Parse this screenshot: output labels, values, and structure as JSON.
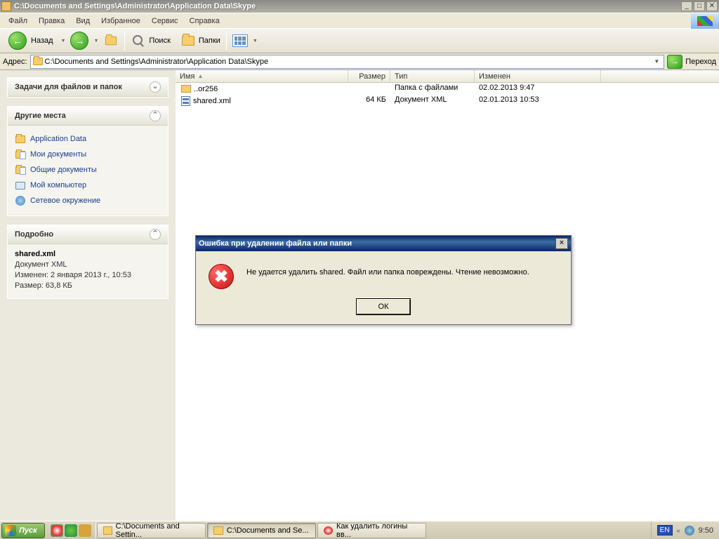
{
  "window": {
    "title": "C:\\Documents and Settings\\Administrator\\Application Data\\Skype"
  },
  "menu": {
    "items": [
      "Файл",
      "Правка",
      "Вид",
      "Избранное",
      "Сервис",
      "Справка"
    ]
  },
  "toolbar": {
    "back": "Назад",
    "search": "Поиск",
    "folders": "Папки"
  },
  "addressbar": {
    "label": "Адрес:",
    "value": "C:\\Documents and Settings\\Administrator\\Application Data\\Skype",
    "go": "Переход"
  },
  "panels": {
    "tasks": {
      "title": "Задачи для файлов и папок"
    },
    "places": {
      "title": "Другие места",
      "items": [
        "Application Data",
        "Мои документы",
        "Общие документы",
        "Мой компьютер",
        "Сетевое окружение"
      ]
    },
    "details": {
      "title": "Подробно",
      "file": "shared.xml",
      "type": "Документ XML",
      "modified": "Изменен: 2 января 2013 г., 10:53",
      "size": "Размер: 63,8 КБ"
    }
  },
  "columns": {
    "name": "Имя",
    "size": "Размер",
    "type": "Тип",
    "modified": "Изменен"
  },
  "files": [
    {
      "name": "..or256",
      "size": "",
      "type": "Папка с файлами",
      "modified": "02.02.2013 9:47",
      "kind": "folder"
    },
    {
      "name": "shared.xml",
      "size": "64 КБ",
      "type": "Документ XML",
      "modified": "02.01.2013 10:53",
      "kind": "xml"
    }
  ],
  "dialog": {
    "title": "Ошибка при удалении файла или папки",
    "message": "Не удается удалить shared. Файл или папка повреждены. Чтение невозможно.",
    "ok": "ОК"
  },
  "taskbar": {
    "start": "Пуск",
    "buttons": [
      "C:\\Documents and Settin...",
      "C:\\Documents and Se...",
      "Как удалить логины вв..."
    ],
    "lang": "EN",
    "clock": "9:50"
  }
}
